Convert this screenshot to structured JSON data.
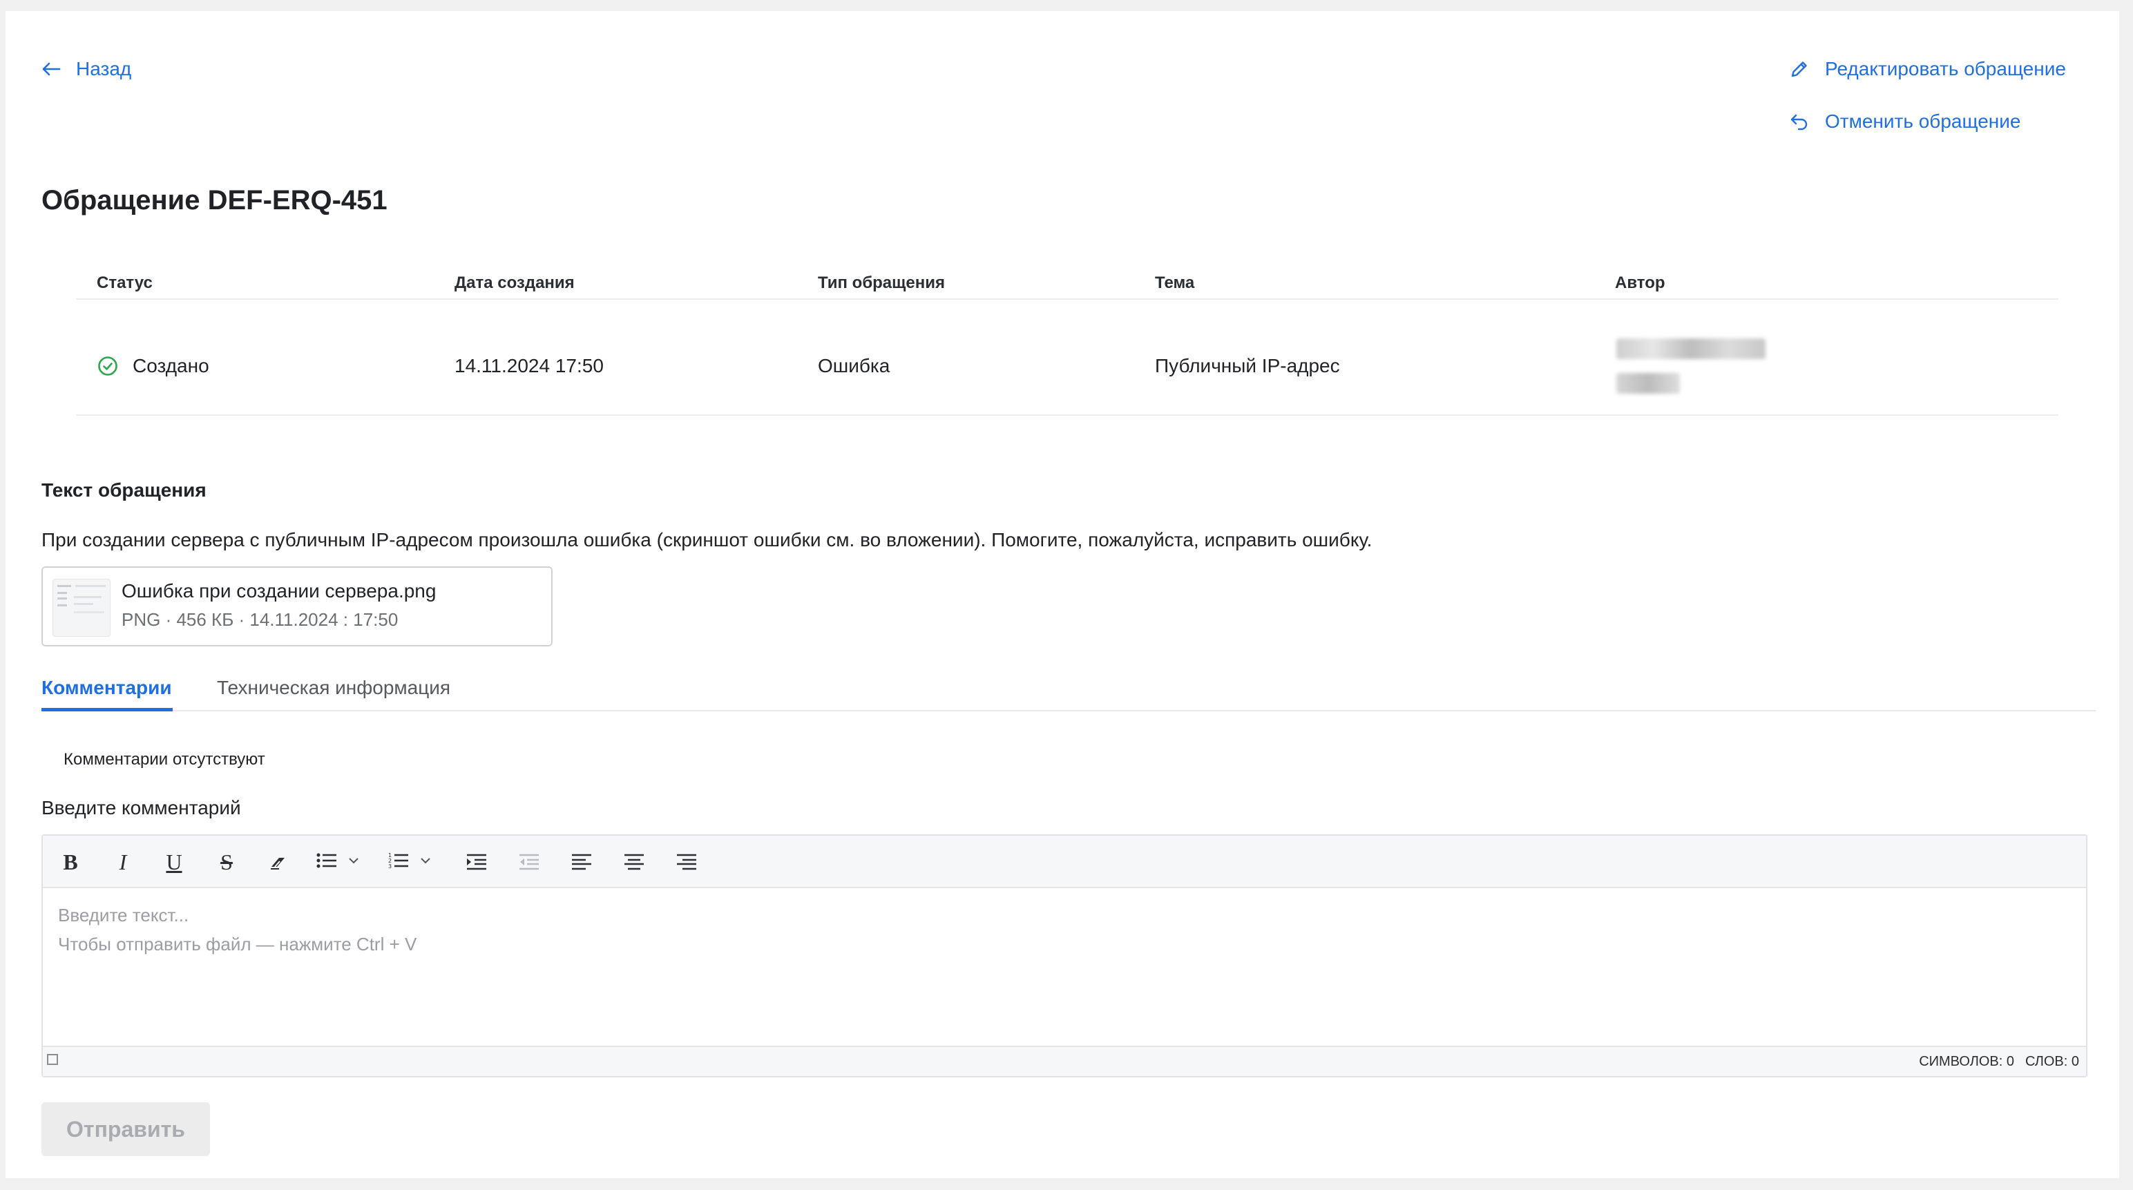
{
  "nav": {
    "back_label": "Назад",
    "edit_label": "Редактировать обращение",
    "cancel_label": "Отменить обращение"
  },
  "ticket": {
    "title": "Обращение DEF-ERQ-451",
    "columns": [
      "Статус",
      "Дата создания",
      "Тип обращения",
      "Тема",
      "Автор"
    ],
    "status": "Создано",
    "created": "14.11.2024 17:50",
    "type": "Ошибка",
    "topic": "Публичный IP-адрес",
    "status_color": "#2aa84f"
  },
  "request": {
    "section_title": "Текст обращения",
    "text": "При создании сервера с публичным IP-адресом произошла ошибка (скриншот ошибки см. во вложении). Помогите, пожалуйста, исправить ошибку."
  },
  "attachment": {
    "name": "Ошибка при создании сервера.png",
    "meta": "PNG · 456 КБ · 14.11.2024 : 17:50"
  },
  "tabs": [
    {
      "label": "Комментарии",
      "active": true
    },
    {
      "label": "Техническая информация",
      "active": false
    }
  ],
  "comments": {
    "empty_text": "Комментарии отсутствуют",
    "input_label": "Введите комментарий",
    "placeholder_line1": "Введите текст...",
    "placeholder_line2": "Чтобы отправить файл — нажмите Ctrl + V",
    "chars_label": "СИМВОЛОВ: 0",
    "words_label": "СЛОВ: 0",
    "toolbar": {
      "bold": "B",
      "italic": "I",
      "underline": "U",
      "strike": "S"
    },
    "send_label": "Отправить"
  },
  "colors": {
    "accent": "#1f6fe0",
    "text": "#1f2226",
    "muted": "#6b7075"
  }
}
